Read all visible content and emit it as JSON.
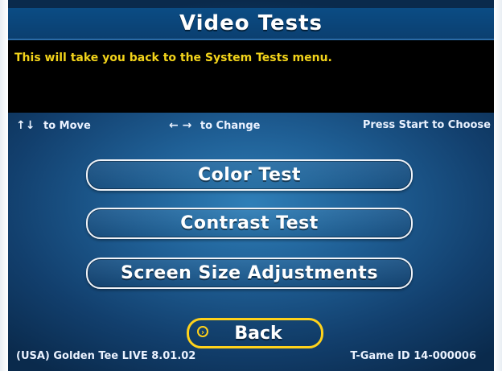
{
  "header": {
    "title": "Video Tests"
  },
  "message": {
    "text": "This will take you back to the System Tests menu."
  },
  "hints": {
    "move_arrows": "↑↓",
    "move_label": "to Move",
    "change_arrows": "← →",
    "change_label": "to Change",
    "choose_label": "Press Start to Choose"
  },
  "menu": {
    "items": [
      {
        "label": "Color Test"
      },
      {
        "label": "Contrast Test"
      },
      {
        "label": "Screen Size Adjustments"
      }
    ],
    "back_label": "Back",
    "selected": "Back"
  },
  "footer": {
    "version": "(USA) Golden Tee LIVE 8.01.02",
    "game_id": "T-Game ID 14-000006"
  },
  "colors": {
    "accent_yellow": "#ffd21b",
    "message_text": "#f2d31a",
    "title_bar": "#0b4c84",
    "background_center": "#2f7fb8",
    "background_edge": "#0a2a4c"
  }
}
